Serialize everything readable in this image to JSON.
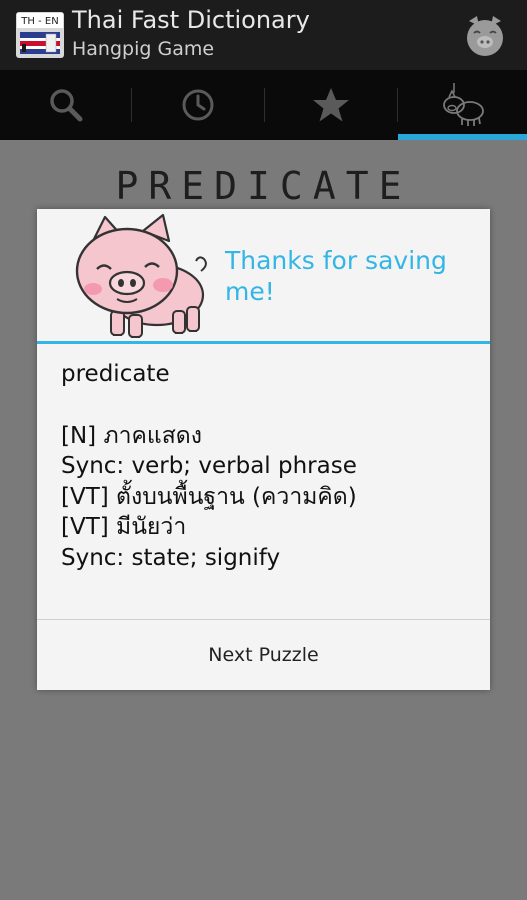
{
  "actionbar": {
    "app_icon_text": "TH - EN",
    "title": "Thai Fast Dictionary",
    "subtitle": "Hangpig Game",
    "pig_button_icon": "pig-face-icon"
  },
  "tabs": [
    {
      "icon": "search-icon",
      "selected": false
    },
    {
      "icon": "history-clock-icon",
      "selected": false
    },
    {
      "icon": "star-icon",
      "selected": false
    },
    {
      "icon": "hangpig-icon",
      "selected": true
    }
  ],
  "background": {
    "word": "PREDICATE",
    "partial_glyph": "t"
  },
  "dialog": {
    "title": "Thanks for saving me!",
    "word": "predicate",
    "definitions": [
      "[N] ภาคแสดง",
      "Sync: verb; verbal phrase",
      "[VT] ตั้งบนพื้นฐาน (ความคิด)",
      "[VT] มีนัยว่า",
      "Sync: state; signify"
    ],
    "button_label": "Next Puzzle"
  },
  "colors": {
    "accent": "#33b5e5",
    "actionbar": "#1c1c1c",
    "tabbar": "#0a0a0a",
    "dim_background": "#7a7a7a"
  }
}
